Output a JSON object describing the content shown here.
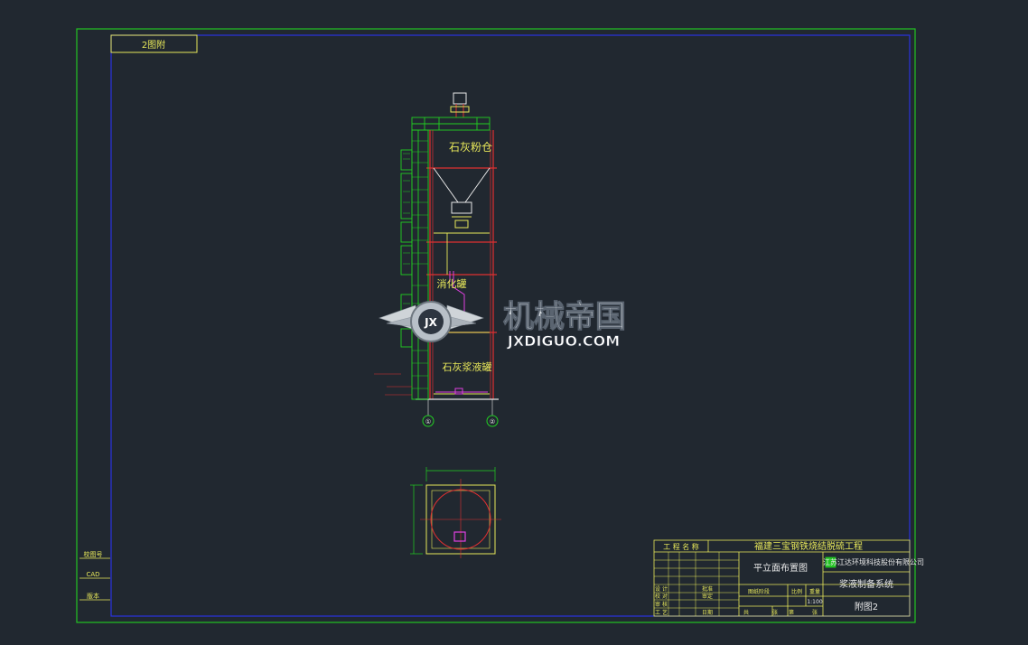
{
  "drawing": {
    "background": "#212830",
    "border_color": "#22c322",
    "inner_border_color": "#1a22c8",
    "line_yellow": "#e8e85a",
    "line_red": "#e03030",
    "line_magenta": "#e040e0",
    "line_green": "#22d022"
  },
  "corner_tag": "2图附",
  "labels": {
    "silo": "石灰粉仓",
    "slaker": "消化罐",
    "slurry_tank": "石灰浆液罐"
  },
  "axis_markers": [
    "①",
    "②"
  ],
  "watermark": {
    "cn": "机械帝国",
    "en": "JXDIGUO.COM",
    "badge": "JX"
  },
  "side_stamps": [
    "校图号",
    "CAD",
    "版本"
  ],
  "title_block": {
    "project_label": "工 程 名 称",
    "project_name": "福建三宝钢铁烧结脱硫工程",
    "drawing_name": "平立面布置图",
    "company": "江苏江达环境科技股份有限公司",
    "system": "浆液制备系统",
    "sheet_no": "附图2",
    "scale": "1:100",
    "roles": [
      "设 计",
      "校 对",
      "审 核",
      "工 艺"
    ],
    "small_cells": [
      "批准",
      "审定",
      "日期",
      "共",
      "张",
      "第",
      "张",
      "图纸阶段",
      "比例",
      "重量"
    ]
  }
}
